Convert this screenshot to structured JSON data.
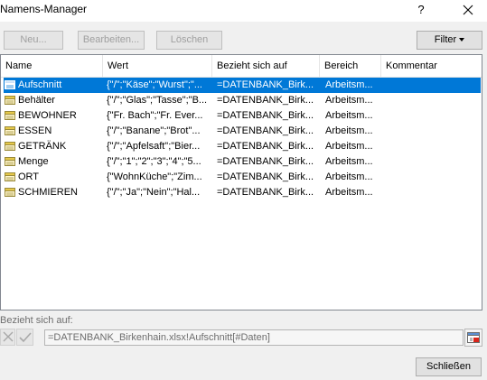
{
  "window": {
    "title": "Namens-Manager",
    "help_label": "?"
  },
  "toolbar": {
    "new_label": "Neu...",
    "edit_label": "Bearbeiten...",
    "delete_label": "Löschen",
    "filter_label": "Filter"
  },
  "table": {
    "columns": [
      "Name",
      "Wert",
      "Bezieht sich auf",
      "Bereich",
      "Kommentar"
    ],
    "rows": [
      {
        "name": "Aufschnitt",
        "value": "{\"/\";\"Käse\";\"Wurst\";\"...",
        "ref": "=DATENBANK_Birk...",
        "scope": "Arbeitsm...",
        "comment": "",
        "selected": true
      },
      {
        "name": "Behälter",
        "value": "{\"/\";\"Glas\";\"Tasse\";\"B...",
        "ref": "=DATENBANK_Birk...",
        "scope": "Arbeitsm...",
        "comment": "",
        "selected": false
      },
      {
        "name": "BEWOHNER",
        "value": "{\"Fr. Bach\";\"Fr. Ever...",
        "ref": "=DATENBANK_Birk...",
        "scope": "Arbeitsm...",
        "comment": "",
        "selected": false
      },
      {
        "name": "ESSEN",
        "value": "{\"/\";\"Banane\";\"Brot\"...",
        "ref": "=DATENBANK_Birk...",
        "scope": "Arbeitsm...",
        "comment": "",
        "selected": false
      },
      {
        "name": "GETRÄNK",
        "value": "{\"/\";\"Apfelsaft\";\"Bier...",
        "ref": "=DATENBANK_Birk...",
        "scope": "Arbeitsm...",
        "comment": "",
        "selected": false
      },
      {
        "name": "Menge",
        "value": "{\"/\";\"1\";\"2\";\"3\";\"4\";\"5...",
        "ref": "=DATENBANK_Birk...",
        "scope": "Arbeitsm...",
        "comment": "",
        "selected": false
      },
      {
        "name": "ORT",
        "value": "{\"WohnKüche\";\"Zim...",
        "ref": "=DATENBANK_Birk...",
        "scope": "Arbeitsm...",
        "comment": "",
        "selected": false
      },
      {
        "name": "SCHMIEREN",
        "value": "{\"/\";\"Ja\";\"Nein\";\"Hal...",
        "ref": "=DATENBANK_Birk...",
        "scope": "Arbeitsm...",
        "comment": "",
        "selected": false
      }
    ]
  },
  "reference": {
    "label": "Bezieht sich auf:",
    "value": "=DATENBANK_Birkenhain.xlsx!Aufschnitt[#Daten]"
  },
  "footer": {
    "close_label": "Schließen"
  },
  "colors": {
    "selection": "#0078d7",
    "dialog_bg": "#f0f0f0",
    "disabled_text": "#a0a0a0"
  },
  "icons": {
    "row_icon": "table-name-icon",
    "close": "close-icon",
    "cancel": "cancel-x-icon",
    "confirm": "confirm-check-icon",
    "collapse": "collapse-dialog-icon"
  }
}
